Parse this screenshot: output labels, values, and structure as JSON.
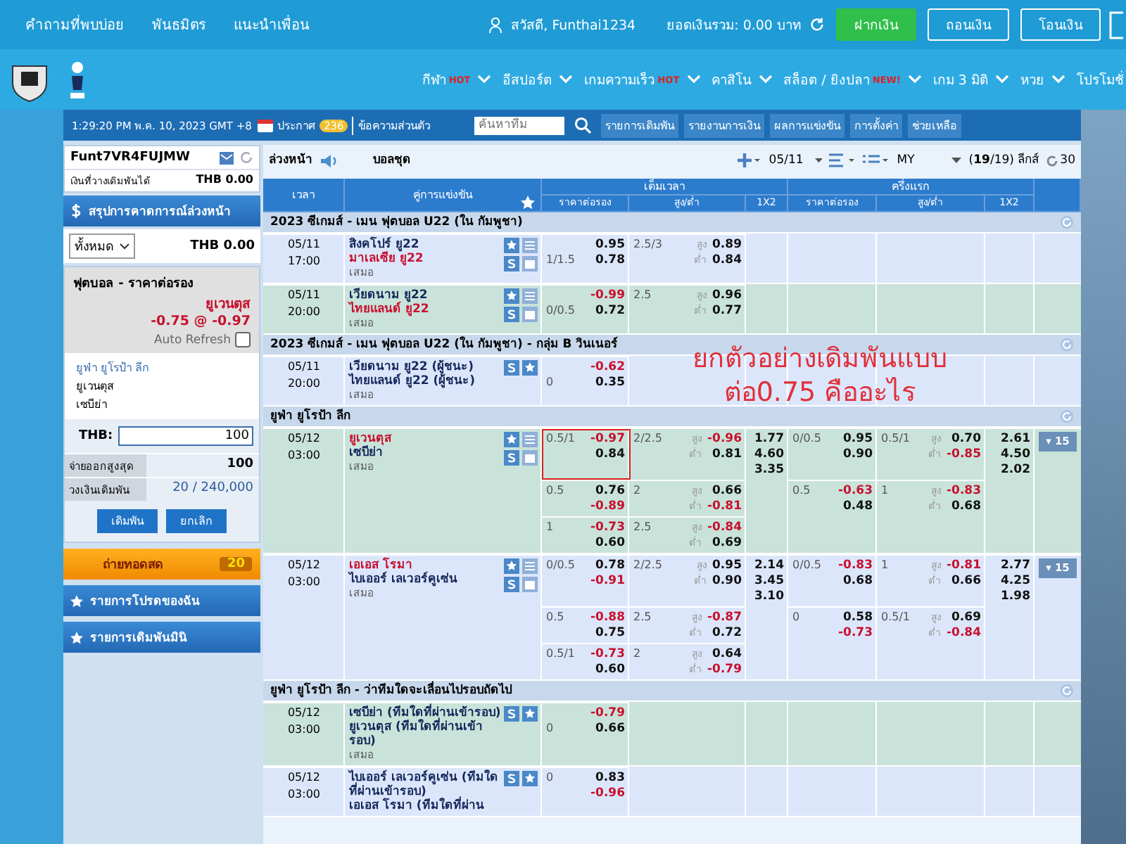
{
  "top_bar": {
    "links": [
      "คำถามที่พบบ่อย",
      "พันธมิตร",
      "แนะนำเพื่อน"
    ],
    "greeting": "สวัสดี, Funthai1234",
    "balance": "ยอดเงินรวม: 0.00 บาท",
    "buttons": [
      {
        "label": "ฝากเงิน",
        "kind": "primary"
      },
      {
        "label": "ถอนเงิน",
        "kind": "outline"
      },
      {
        "label": "โอนเงิน",
        "kind": "outline"
      }
    ]
  },
  "nav": [
    {
      "label": "กีฬา",
      "badge": "HOT"
    },
    {
      "label": "อีสปอร์ต"
    },
    {
      "label": "เกมความเร็ว",
      "badge": "HOT"
    },
    {
      "label": "คาสิโน"
    },
    {
      "label": "สล็อต / ยิงปลา",
      "badge": "NEW!"
    },
    {
      "label": "เกม 3 มิติ"
    },
    {
      "label": "หวย"
    },
    {
      "label": "โปรโมชั่"
    }
  ],
  "info_bar": {
    "clock": "1:29:20 PM พ.ค. 10, 2023 GMT +8",
    "announcement": "ประกาศ",
    "announcement_count": "236",
    "messages": "ข้อความส่วนตัว",
    "search": {
      "placeholder": "ค้นหาทีม"
    },
    "buttons": [
      "รายการเดิมพัน",
      "รายงานการเงิน",
      "ผลการแข่งขัน",
      "การตั้งค่า",
      "ช่วยเหลือ"
    ]
  },
  "sidebar": {
    "account": "Funt7VR4FUJMW",
    "credit_label": "เงินที่วางเดิมพันได้",
    "credit": "THB 0.00",
    "summary_title": "สรุปการคาดการณ์ล่วงหน้า",
    "filter": "ทั้งหมด",
    "summary_amount": "THB 0.00",
    "bet_slip": {
      "title": "ฟุตบอล - ราคาต่อรอง",
      "pick": "ยูเวนตุส",
      "odds": "-0.75 @ -0.97",
      "auto_refresh": {
        "label": "Auto Refresh",
        "checked": false
      },
      "league": "ยูฟ่า ยูโรป้า ลีก",
      "teams": [
        "ยูเวนตุส",
        "เซบีย่า"
      ],
      "stake_label": "THB:",
      "stake": "100",
      "rows": [
        {
          "label": "จ่ายออกสูงสุด",
          "value": "100",
          "kind": "bold"
        },
        {
          "label": "วงเงินเดิมพัน",
          "value": "20 / 240,000",
          "kind": "plain"
        }
      ],
      "buttons": [
        "เดิมพัน",
        "ยกเลิก"
      ]
    },
    "live": {
      "label": "ถ่ายทอดสด",
      "count": "20"
    },
    "sections": [
      "รายการโปรดของฉัน",
      "รายการเดิมพันมินิ"
    ]
  },
  "toolbar": {
    "mode": "ล่วงหน้า",
    "market": "บอลชุด",
    "date": "05/11",
    "odds_type": "MY",
    "leagues": "(**19**/19) ลีกส์",
    "refresh": "30"
  },
  "table": {
    "columns": [
      "เวลา",
      "คู่การแข่งขัน"
    ],
    "groups": [
      "เต็มเวลา",
      "ครึ่งแรก"
    ],
    "subcolumns": [
      "ราคาต่อรอง",
      "สูง/ต่ำ",
      "1X2",
      "ราคาต่อรอง",
      "สูง/ต่ำ",
      "1X2"
    ],
    "leagues": [
      {
        "name": "2023 ซีเกมส์ - เมน ฟุตบอล U22 (ใน กัมพูชา)",
        "matches": [
          {
            "date": "05/11",
            "time": "17:00",
            "teams": [
              {
                "name": "สิงคโปร์ ยู22",
                "favored": false
              },
              {
                "name": "มาเลเซีย ยู22",
                "favored": true
              }
            ],
            "draw": "เสมอ",
            "stats": true,
            "highlight": false,
            "lines": [
              {
                "ft": {
                  "home": "0.95",
                  "hdp_away": "1/1.5",
                  "away": "0.78",
                  "ou": "2.5/3",
                  "over_label": "สูง",
                  "under_label": "ต่ำ",
                  "over": "0.89",
                  "under": "0.84"
                }
              }
            ]
          },
          {
            "date": "05/11",
            "time": "20:00",
            "teams": [
              {
                "name": "เวียดนาม ยู22",
                "favored": false
              },
              {
                "name": "ไทยแลนด์ ยู22",
                "favored": true
              }
            ],
            "draw": "เสมอ",
            "stats": true,
            "highlight": true,
            "lines": [
              {
                "ft": {
                  "home": "-0.99",
                  "hdp_away": "0/0.5",
                  "away": "0.72",
                  "ou": "2.5",
                  "over_label": "สูง",
                  "under_label": "ต่ำ",
                  "over": "0.96",
                  "under": "0.77"
                }
              }
            ]
          }
        ]
      },
      {
        "name": "2023 ซีเกมส์ - เมน ฟุตบอล U22 (ใน กัมพูชา) - กลุ่ม B วินเนอร์",
        "matches": [
          {
            "date": "05/11",
            "time": "20:00",
            "teams": [
              {
                "name": "เวียดนาม ยู22 (ผู้ชนะ)",
                "favored": false
              },
              {
                "name": "ไทยแลนด์ ยู22 (ผู้ชนะ)",
                "favored": false
              }
            ],
            "draw": "เสมอ",
            "stats": false,
            "highlight": false,
            "lines": [
              {
                "ft": {
                  "home": "-0.62",
                  "hdp_away": "0",
                  "away": "0.35"
                }
              }
            ]
          }
        ]
      },
      {
        "name": "ยูฟ่า ยูโรป้า ลีก",
        "matches": [
          {
            "date": "05/12",
            "time": "03:00",
            "teams": [
              {
                "name": "ยูเวนตุส",
                "favored": true
              },
              {
                "name": "เซบีย่า",
                "favored": false
              }
            ],
            "draw": "เสมอ",
            "stats": true,
            "highlight": true,
            "more": {
              "icon": "▾",
              "count": "15"
            },
            "lines": [
              {
                "boxed": true,
                "ft": {
                  "hdp_home": "0.5/1",
                  "home": "-0.97",
                  "away": "0.84",
                  "ou": "2/2.5",
                  "over_label": "สูง",
                  "under_label": "ต่ำ",
                  "over": "-0.96",
                  "under": "0.81",
                  "x12": [
                    "1.77",
                    "4.60",
                    "3.35"
                  ]
                },
                "fh": {
                  "hdp_home": "0/0.5",
                  "home": "0.95",
                  "away": "0.90",
                  "ou": "0.5/1",
                  "over_label": "สูง",
                  "under_label": "ต่ำ",
                  "over": "0.70",
                  "under": "-0.85",
                  "x12": [
                    "2.61",
                    "4.50",
                    "2.02"
                  ]
                }
              },
              {
                "ft": {
                  "hdp_home": "0.5",
                  "home": "0.76",
                  "away": "-0.89",
                  "ou": "2",
                  "over_label": "สูง",
                  "under_label": "ต่ำ",
                  "over": "0.66",
                  "under": "-0.81"
                },
                "fh": {
                  "hdp_home": "0.5",
                  "home": "-0.63",
                  "away": "0.48",
                  "ou": "1",
                  "over_label": "สูง",
                  "under_label": "ต่ำ",
                  "over": "-0.83",
                  "under": "0.68"
                }
              },
              {
                "ft": {
                  "hdp_home": "1",
                  "home": "-0.73",
                  "away": "0.60",
                  "ou": "2.5",
                  "over_label": "สูง",
                  "under_label": "ต่ำ",
                  "over": "-0.84",
                  "under": "0.69"
                }
              }
            ]
          },
          {
            "date": "05/12",
            "time": "03:00",
            "teams": [
              {
                "name": "เอเอส โรมา",
                "favored": true
              },
              {
                "name": "ไบเออร์ เลเวอร์คูเซ่น",
                "favored": false
              }
            ],
            "draw": "เสมอ",
            "stats": true,
            "highlight": false,
            "more": {
              "icon": "▾",
              "count": "15"
            },
            "lines": [
              {
                "ft": {
                  "hdp_home": "0/0.5",
                  "home": "0.78",
                  "away": "-0.91",
                  "ou": "2/2.5",
                  "over_label": "สูง",
                  "under_label": "ต่ำ",
                  "over": "0.95",
                  "under": "0.90",
                  "x12": [
                    "2.14",
                    "3.45",
                    "3.10"
                  ]
                },
                "fh": {
                  "hdp_home": "0/0.5",
                  "home": "-0.83",
                  "away": "0.68",
                  "ou": "1",
                  "over_label": "สูง",
                  "under_label": "ต่ำ",
                  "over": "-0.81",
                  "under": "0.66",
                  "x12": [
                    "2.77",
                    "4.25",
                    "1.98"
                  ]
                }
              },
              {
                "ft": {
                  "hdp_home": "0.5",
                  "home": "-0.88",
                  "away": "0.75",
                  "ou": "2.5",
                  "over_label": "สูง",
                  "under_label": "ต่ำ",
                  "over": "-0.87",
                  "under": "0.72"
                },
                "fh": {
                  "hdp_home": "0",
                  "home": "0.58",
                  "away": "-0.73",
                  "ou": "0.5/1",
                  "over_label": "สูง",
                  "under_label": "ต่ำ",
                  "over": "0.69",
                  "under": "-0.84"
                }
              },
              {
                "ft": {
                  "hdp_home": "0.5/1",
                  "home": "-0.73",
                  "away": "0.60",
                  "ou": "2",
                  "over_label": "สูง",
                  "under_label": "ต่ำ",
                  "over": "0.64",
                  "under": "-0.79"
                }
              }
            ]
          }
        ]
      },
      {
        "name": "ยูฟ่า ยูโรป้า ลีก - ว่าทีมใดจะเลื่อนไปรอบถัดไป",
        "matches": [
          {
            "date": "05/12",
            "time": "03:00",
            "teams": [
              {
                "name": "เซบีย่า (ทีมใดที่ผ่านเข้ารอบ)",
                "favored": false
              },
              {
                "name": "ยูเวนตุส (ทีมใดที่ผ่านเข้ารอบ)",
                "favored": false
              }
            ],
            "draw": "เสมอ",
            "stats": false,
            "highlight": true,
            "lines": [
              {
                "ft": {
                  "home": "-0.79",
                  "hdp_away": "0",
                  "away": "0.66"
                }
              }
            ]
          },
          {
            "date": "05/12",
            "time": "03:00",
            "teams": [
              {
                "name": "ไบเออร์ เลเวอร์คูเซ่น (ทีมใดที่ผ่านเข้ารอบ)",
                "favored": false
              },
              {
                "name": "เอเอส โรมา (ทีมใดที่ผ่าน",
                "favored": false
              }
            ],
            "stats": false,
            "highlight": false,
            "lines": [
              {
                "ft": {
                  "hdp_home": "0",
                  "home": "0.83",
                  "away": "-0.96"
                }
              }
            ]
          }
        ]
      }
    ]
  },
  "annotation": [
    "ยกตัวอย่างเดิมพันแบบ",
    "ต่อ0.75 คืออะไร"
  ]
}
